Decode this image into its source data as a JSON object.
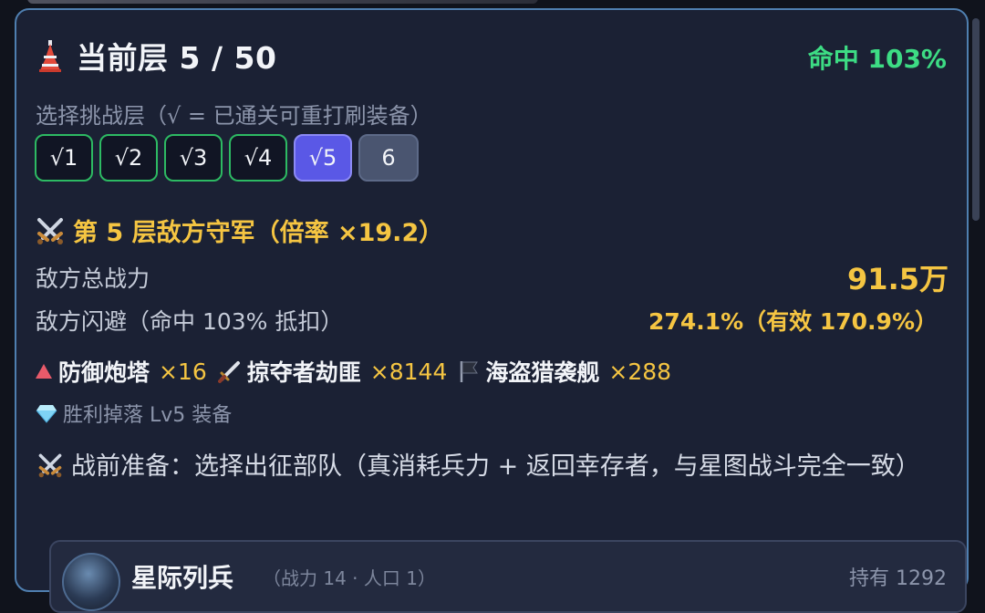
{
  "header": {
    "floor_title": "当前层 5 / 50",
    "hit_rate": "命中 103%"
  },
  "floor_select": {
    "label": "选择挑战层（√ = 已通关可重打刷装备）",
    "buttons": [
      {
        "label": "√1",
        "state": "cleared"
      },
      {
        "label": "√2",
        "state": "cleared"
      },
      {
        "label": "√3",
        "state": "cleared"
      },
      {
        "label": "√4",
        "state": "cleared"
      },
      {
        "label": "√5",
        "state": "selected"
      },
      {
        "label": "6",
        "state": "locked"
      }
    ]
  },
  "enemy": {
    "title": "第 5 层敌方守军（倍率 ×19.2）",
    "power_label": "敌方总战力",
    "power_value": "91.5万",
    "dodge_label": "敌方闪避（命中 103% 抵扣）",
    "dodge_value": "274.1%（有效 170.9%）",
    "units": [
      {
        "icon": "triangle-icon",
        "name": "防御炮塔",
        "count": "×16"
      },
      {
        "icon": "dagger-icon",
        "name": "掠夺者劫匪",
        "count": "×8144"
      },
      {
        "icon": "flag-icon",
        "name": "海盗猎袭舰",
        "count": "×288"
      }
    ],
    "drop": "胜利掉落 Lv5 装备"
  },
  "prep": {
    "text": "战前准备：选择出征部队（真消耗兵力 + 返回幸存者，与星图战斗完全一致）"
  },
  "squad": {
    "name": "星际列兵",
    "sub": "（战力 14 · 人口 1）",
    "held": "持有 1292"
  },
  "colors": {
    "accent_green": "#3ddc84",
    "accent_gold": "#f5c542",
    "selected_purple": "#5a58e6",
    "panel_border": "#4f7fb0"
  }
}
